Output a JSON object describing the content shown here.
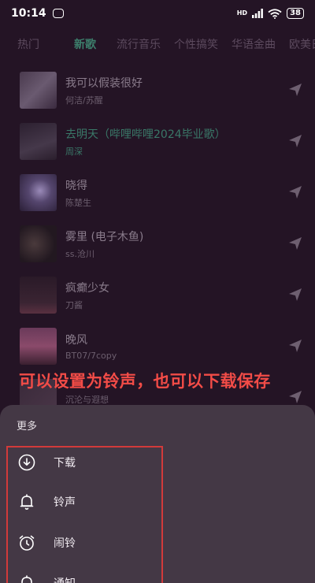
{
  "status_bar": {
    "time": "10:14",
    "signal_label": "HD",
    "battery": "38"
  },
  "tabs": [
    {
      "label": "热门"
    },
    {
      "label": "新歌"
    },
    {
      "label": "流行音乐"
    },
    {
      "label": "个性搞笑"
    },
    {
      "label": "华语金曲"
    },
    {
      "label": "欧美日"
    }
  ],
  "songs": [
    {
      "title": "我可以假装很好",
      "artist": "何洁/苏醒"
    },
    {
      "title": "去明天（哔哩哔哩2024毕业歌）",
      "artist": "周深"
    },
    {
      "title": "晓得",
      "artist": "陈楚生"
    },
    {
      "title": "雾里 (电子木鱼)",
      "artist": "ss.沧川"
    },
    {
      "title": "疯癫少女",
      "artist": "刀酱"
    },
    {
      "title": "晚风",
      "artist": "BT07/7copy"
    },
    {
      "title": "",
      "artist": "沉沦与遐想"
    }
  ],
  "caption": "可以设置为铃声，也可以下载保存",
  "sheet": {
    "title": "更多",
    "items": [
      {
        "label": "下载",
        "icon": "download-icon"
      },
      {
        "label": "铃声",
        "icon": "bell-icon"
      },
      {
        "label": "闹铃",
        "icon": "alarm-clock-icon"
      },
      {
        "label": "通知",
        "icon": "notification-icon"
      }
    ]
  },
  "colors": {
    "background": "#241425",
    "active_tab": "#3d7f6c",
    "caption_red": "#f24c47",
    "sheet_bg": "#443845",
    "frame_red": "#d23a3a"
  }
}
